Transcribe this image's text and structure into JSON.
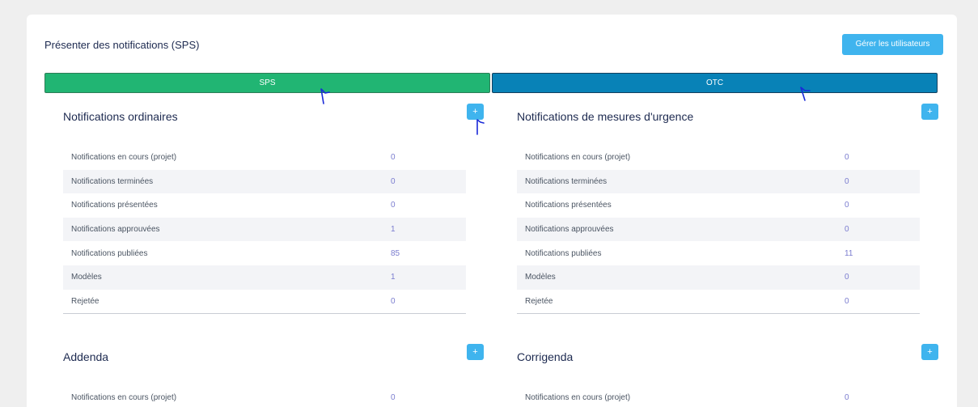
{
  "header": {
    "title": "Présenter des notifications (SPS)",
    "manage_users_label": "Gérer les utilisateurs"
  },
  "tabs": [
    {
      "label": "SPS",
      "color": "#21b573"
    },
    {
      "label": "OTC",
      "color": "#0882b7"
    }
  ],
  "sections": [
    {
      "title": "Notifications ordinaires",
      "add_label": "+",
      "rows": [
        {
          "label": "Notifications en cours (projet)",
          "value": "0"
        },
        {
          "label": "Notifications terminées",
          "value": "0"
        },
        {
          "label": "Notifications présentées",
          "value": "0"
        },
        {
          "label": "Notifications approuvées",
          "value": "1"
        },
        {
          "label": "Notifications publiées",
          "value": "85"
        },
        {
          "label": "Modèles",
          "value": "1"
        },
        {
          "label": "Rejetée",
          "value": "0"
        }
      ]
    },
    {
      "title": "Notifications de mesures d'urgence",
      "add_label": "+",
      "rows": [
        {
          "label": "Notifications en cours (projet)",
          "value": "0"
        },
        {
          "label": "Notifications terminées",
          "value": "0"
        },
        {
          "label": "Notifications présentées",
          "value": "0"
        },
        {
          "label": "Notifications approuvées",
          "value": "0"
        },
        {
          "label": "Notifications publiées",
          "value": "11"
        },
        {
          "label": "Modèles",
          "value": "0"
        },
        {
          "label": "Rejetée",
          "value": "0"
        }
      ]
    },
    {
      "title": "Addenda",
      "add_label": "+",
      "rows": [
        {
          "label": "Notifications en cours (projet)",
          "value": "0"
        }
      ]
    },
    {
      "title": "Corrigenda",
      "add_label": "+",
      "rows": [
        {
          "label": "Notifications en cours (projet)",
          "value": "0"
        }
      ]
    }
  ],
  "colors": {
    "accent": "#3fb4ee",
    "value_text": "#7a7ccf",
    "annotation": "#1a2ad8"
  }
}
